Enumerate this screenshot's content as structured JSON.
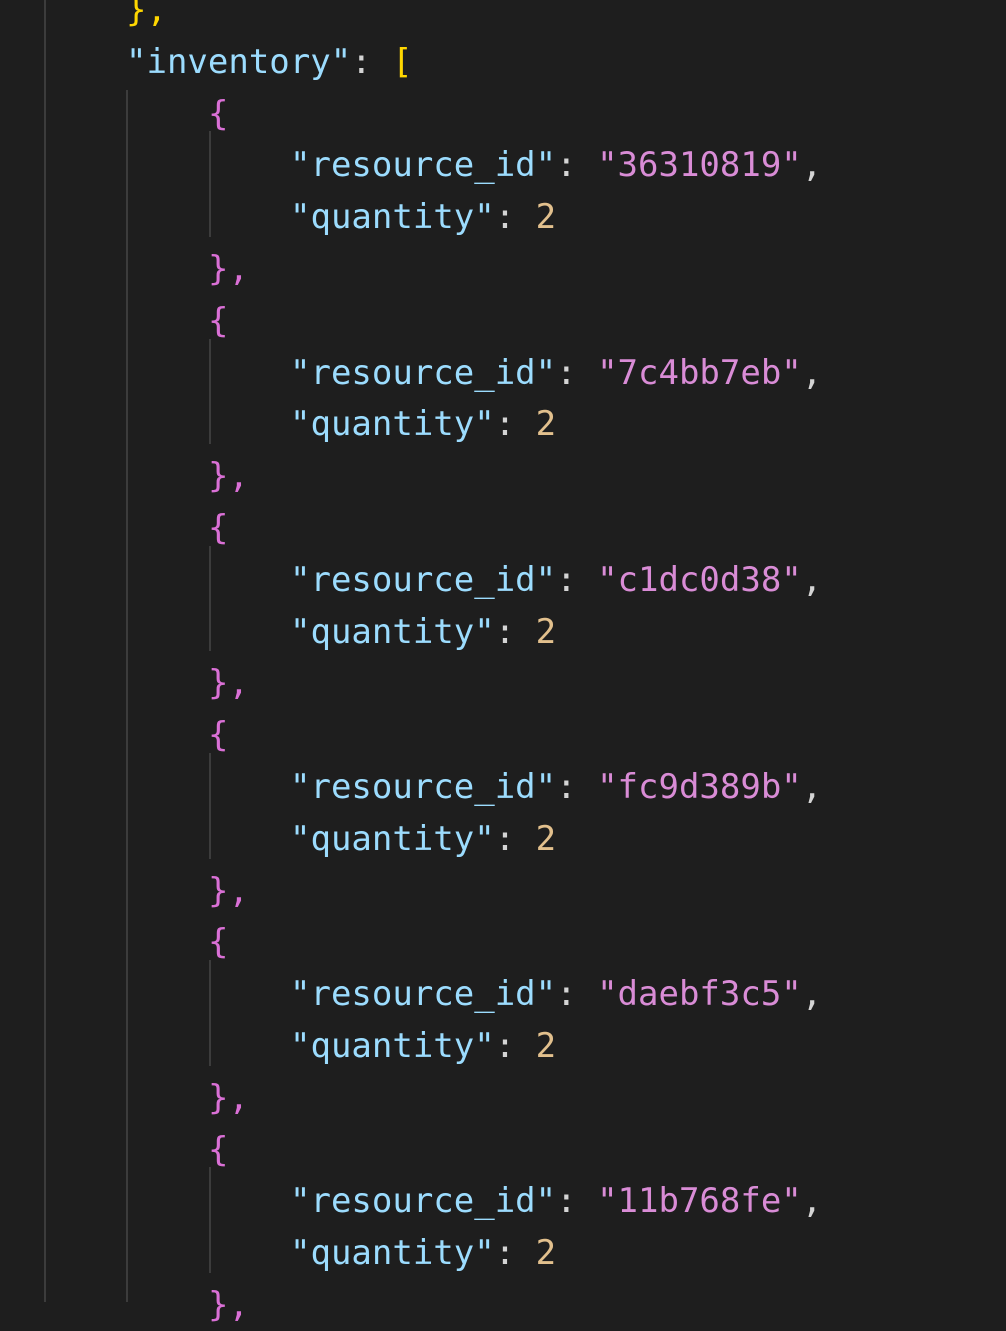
{
  "editor": {
    "language": "json",
    "colors": {
      "background": "#1e1e1e",
      "key": "#9cdcfe",
      "string": "#d98cd6",
      "number": "#e2c08d",
      "bracket_outer": "#ffd700",
      "bracket_inner": "#da70d6",
      "punctuation": "#d4d4d4",
      "indent_guide": "#3c3c3c"
    },
    "lines": {
      "close_prev": "},",
      "inventory_key": "\"inventory\"",
      "colon": ": ",
      "open_bracket": "[",
      "open_brace": "{",
      "close_brace": "},",
      "resource_id_key": "\"resource_id\"",
      "quantity_key": "\"quantity\"",
      "comma": ","
    },
    "inventory": [
      {
        "resource_id": "\"36310819\"",
        "quantity": "2"
      },
      {
        "resource_id": "\"7c4bb7eb\"",
        "quantity": "2"
      },
      {
        "resource_id": "\"c1dc0d38\"",
        "quantity": "2"
      },
      {
        "resource_id": "\"fc9d389b\"",
        "quantity": "2"
      },
      {
        "resource_id": "\"daebf3c5\"",
        "quantity": "2"
      },
      {
        "resource_id": "\"11b768fe\"",
        "quantity": "2"
      }
    ]
  }
}
